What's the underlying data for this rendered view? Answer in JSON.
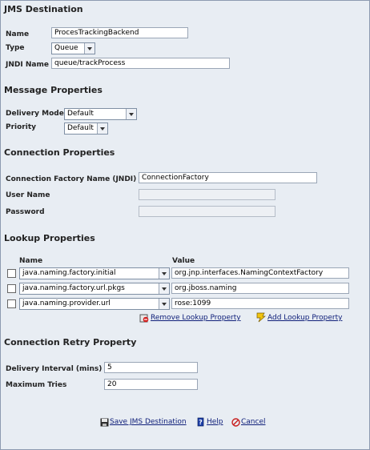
{
  "jms_destination": {
    "title": "JMS Destination",
    "name_label": "Name",
    "name_value": "ProcesTrackingBackend",
    "type_label": "Type",
    "type_value": "Queue",
    "jndi_label": "JNDI Name",
    "jndi_value": "queue/trackProcess"
  },
  "message_properties": {
    "title": "Message Properties",
    "delivery_mode_label": "Delivery Mode",
    "delivery_mode_value": "Default",
    "priority_label": "Priority",
    "priority_value": "Default"
  },
  "connection_properties": {
    "title": "Connection Properties",
    "factory_label": "Connection Factory Name (JNDI)",
    "factory_value": "ConnectionFactory",
    "username_label": "User Name",
    "username_value": "",
    "password_label": "Password",
    "password_value": ""
  },
  "lookup_properties": {
    "title": "Lookup Properties",
    "col_name": "Name",
    "col_value": "Value",
    "rows": [
      {
        "name": "java.naming.factory.initial",
        "value": "org.jnp.interfaces.NamingContextFactory"
      },
      {
        "name": "java.naming.factory.url.pkgs",
        "value": "org.jboss.naming"
      },
      {
        "name": "java.naming.provider.url",
        "value": "rose:1099"
      }
    ],
    "remove_label": "Remove Lookup Property",
    "add_label": "Add Lookup Property"
  },
  "retry": {
    "title": "Connection Retry Property",
    "interval_label": "Delivery Interval (mins)",
    "interval_value": "5",
    "tries_label": "Maximum Tries",
    "tries_value": "20"
  },
  "footer": {
    "save_label": "Save JMS Destination",
    "help_label": "Help",
    "cancel_label": "Cancel"
  }
}
